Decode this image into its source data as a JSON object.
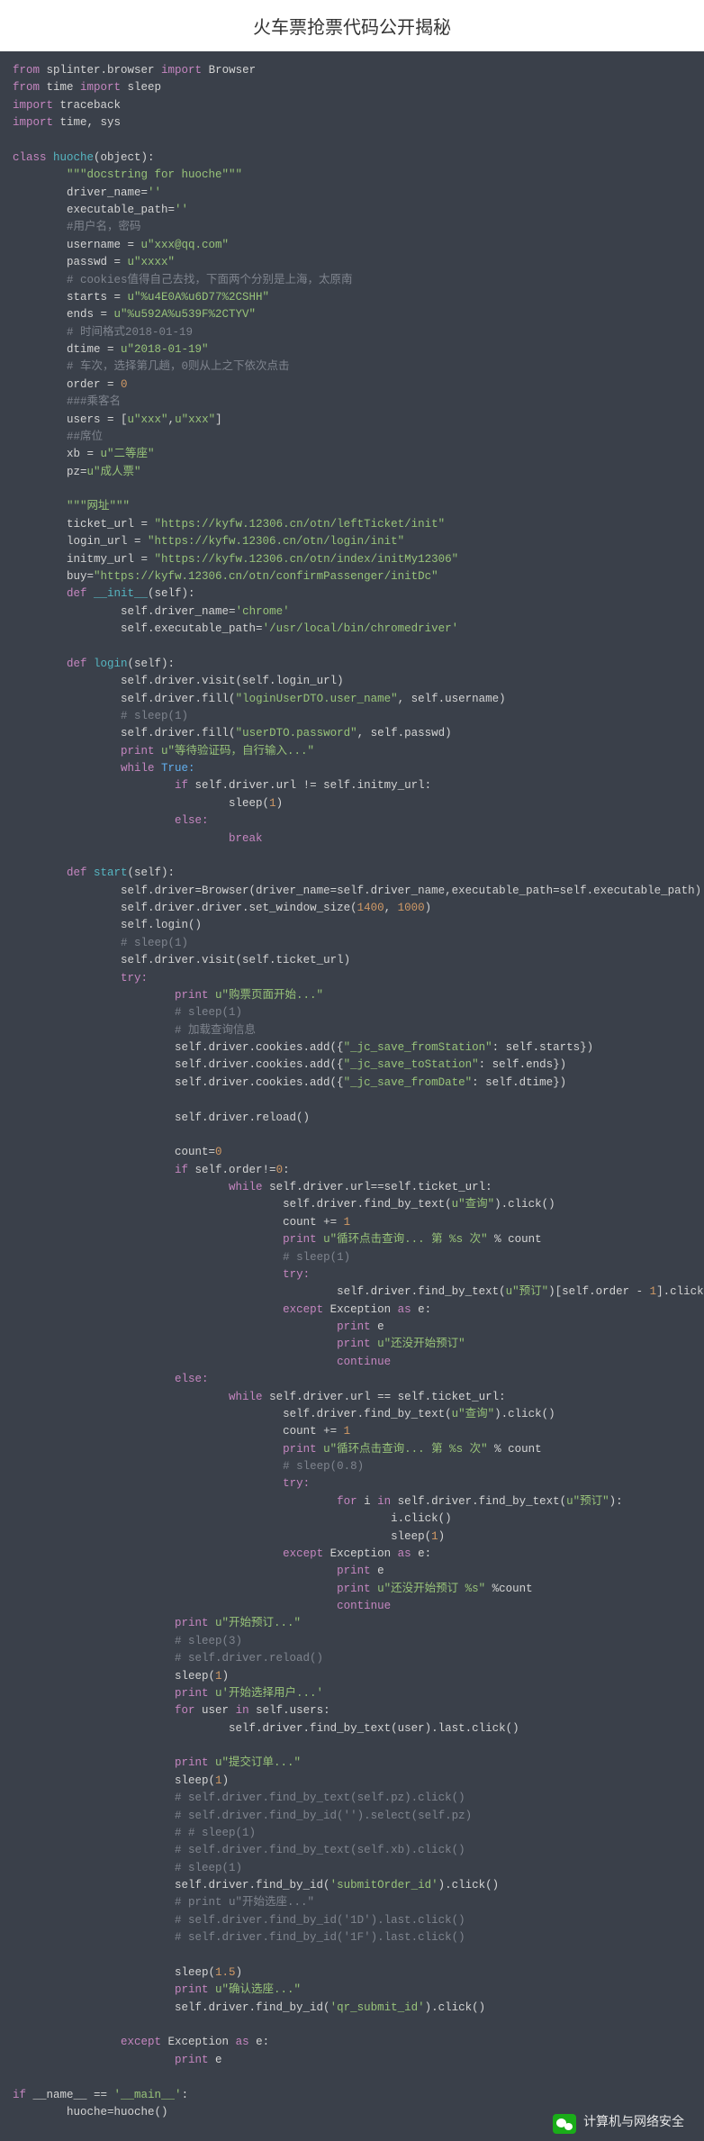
{
  "title": "火车票抢票代码公开揭秘",
  "footer": "计算机与网络安全",
  "code": {
    "l1": {
      "a": "from",
      "b": " splinter.browser ",
      "c": "import",
      "d": " Browser"
    },
    "l2": {
      "a": "from",
      "b": " time ",
      "c": "import",
      "d": " sleep"
    },
    "l3": {
      "a": "import",
      "b": " traceback"
    },
    "l4": {
      "a": "import",
      "b": " time, sys"
    },
    "l5": {
      "a": "class",
      "b": " huoche",
      "c": "(object):"
    },
    "l6": "\"\"\"docstring for huoche\"\"\"",
    "l7": {
      "a": "driver_name=",
      "b": "''"
    },
    "l8": {
      "a": "executable_path=",
      "b": "''"
    },
    "l9": "#用户名，密码",
    "l10": {
      "a": "username = ",
      "b": "u\"xxx@qq.com\""
    },
    "l11": {
      "a": "passwd = ",
      "b": "u\"xxxx\""
    },
    "l12": "# cookies值得自己去找，下面两个分别是上海，太原南",
    "l13": {
      "a": "starts = ",
      "b": "u\"%u4E0A%u6D77%2CSHH\""
    },
    "l14": {
      "a": "ends = ",
      "b": "u\"%u592A%u539F%2CTYV\""
    },
    "l15": "# 时间格式2018-01-19",
    "l16": {
      "a": "dtime = ",
      "b": "u\"2018-01-19\""
    },
    "l17": "# 车次，选择第几趟，0则从上之下依次点击",
    "l18": {
      "a": "order = ",
      "b": "0"
    },
    "l19": "###乘客名",
    "l20": {
      "a": "users = [",
      "b": "u\"xxx\"",
      "c": ",",
      "d": "u\"xxx\"",
      "e": "]"
    },
    "l21": "##席位",
    "l22": {
      "a": "xb = ",
      "b": "u\"二等座\""
    },
    "l23": {
      "a": "pz=",
      "b": "u\"成人票\""
    },
    "l24": "\"\"\"网址\"\"\"",
    "l25": {
      "a": "ticket_url = ",
      "b": "\"https://kyfw.12306.cn/otn/leftTicket/init\""
    },
    "l26": {
      "a": "login_url = ",
      "b": "\"https://kyfw.12306.cn/otn/login/init\""
    },
    "l27": {
      "a": "initmy_url = ",
      "b": "\"https://kyfw.12306.cn/otn/index/initMy12306\""
    },
    "l28": {
      "a": "buy=",
      "b": "\"https://kyfw.12306.cn/otn/confirmPassenger/initDc\""
    },
    "l28b": {
      "a": "def",
      "b": " __init__",
      "c": "(self):"
    },
    "l29": {
      "a": "self.driver_name=",
      "b": "'chrome'"
    },
    "l30": {
      "a": "self.executable_path=",
      "b": "'/usr/local/bin/chromedriver'"
    },
    "l31": {
      "a": "def",
      "b": " login",
      "c": "(self):"
    },
    "l32": "self.driver.visit(self.login_url)",
    "l33": {
      "a": "self.driver.fill(",
      "b": "\"loginUserDTO.user_name\"",
      "c": ", self.username)"
    },
    "l34": "# sleep(1)",
    "l35": {
      "a": "self.driver.fill(",
      "b": "\"userDTO.password\"",
      "c": ", self.passwd)"
    },
    "l36": {
      "a": "print",
      "b": " u\"等待验证码，自行输入...\""
    },
    "l37": {
      "a": "while",
      "b": " True:"
    },
    "l38": {
      "a": "if",
      "b": " self.driver.url != self.initmy_url:"
    },
    "l39": {
      "a": "sleep(",
      "b": "1",
      "c": ")"
    },
    "l40": "else:",
    "l41": "break",
    "l42": {
      "a": "def",
      "b": " start",
      "c": "(self):"
    },
    "l43": "self.driver=Browser(driver_name=self.driver_name,executable_path=self.executable_path)",
    "l44": {
      "a": "self.driver.driver.set_window_size(",
      "b": "1400",
      "c": ", ",
      "d": "1000",
      "e": ")"
    },
    "l45": "self.login()",
    "l46": "# sleep(1)",
    "l47": "self.driver.visit(self.ticket_url)",
    "l48": "try:",
    "l49": {
      "a": "print",
      "b": " u\"购票页面开始...\""
    },
    "l50": "# sleep(1)",
    "l51": "# 加载查询信息",
    "l52": {
      "a": "self.driver.cookies.add({",
      "b": "\"_jc_save_fromStation\"",
      "c": ": self.starts})"
    },
    "l53": {
      "a": "self.driver.cookies.add({",
      "b": "\"_jc_save_toStation\"",
      "c": ": self.ends})"
    },
    "l54": {
      "a": "self.driver.cookies.add({",
      "b": "\"_jc_save_fromDate\"",
      "c": ": self.dtime})"
    },
    "l55": "self.driver.reload()",
    "l56": {
      "a": "count=",
      "b": "0"
    },
    "l57": {
      "a": "if",
      "b": " self.order!=",
      "c": "0",
      "d": ":"
    },
    "l58": {
      "a": "while",
      "b": " self.driver.url==self.ticket_url:"
    },
    "l58b": {
      "a": "self.driver.find_by_text(",
      "b": "u\"查询\"",
      "c": ").click()"
    },
    "l58c": {
      "a": "count += ",
      "b": "1"
    },
    "l59": {
      "a": "print",
      "b": " u\"循环点击查询... 第 %s 次\"",
      "c": " % count"
    },
    "l60": "# sleep(1)",
    "l61": "try:",
    "l62": {
      "a": "self.driver.find_by_text(",
      "b": "u\"预订\"",
      "c": ")[self.order - ",
      "d": "1",
      "e": "].click()"
    },
    "l63": {
      "a": "except",
      "b": " Exception ",
      "c": "as",
      "d": " e:"
    },
    "l64": {
      "a": "print",
      "b": " e"
    },
    "l65": {
      "a": "print",
      "b": " u\"还没开始预订\""
    },
    "l66": "continue",
    "l67": "else:",
    "l68": {
      "a": "while",
      "b": " self.driver.url == self.ticket_url:"
    },
    "l69": {
      "a": "self.driver.find_by_text(",
      "b": "u\"查询\"",
      "c": ").click()"
    },
    "l70": {
      "a": "count += ",
      "b": "1"
    },
    "l71": {
      "a": "print",
      "b": " u\"循环点击查询... 第 %s 次\"",
      "c": " % count"
    },
    "l72": "# sleep(0.8)",
    "l73": "try:",
    "l74": {
      "a": "for",
      "b": " i ",
      "c": "in",
      "d": " self.driver.find_by_text(",
      "e": "u\"预订\"",
      "f": "):"
    },
    "l75": "i.click()",
    "l76": {
      "a": "sleep(",
      "b": "1",
      "c": ")"
    },
    "l77": {
      "a": "except",
      "b": " Exception ",
      "c": "as",
      "d": " e:"
    },
    "l78": {
      "a": "print",
      "b": " e"
    },
    "l79": {
      "a": "print",
      "b": " u\"还没开始预订 %s\"",
      "c": " %count"
    },
    "l80": "continue",
    "l81": {
      "a": "print",
      "b": " u\"开始预订...\""
    },
    "l82": "# sleep(3)",
    "l83": "# self.driver.reload()",
    "l84": {
      "a": "sleep(",
      "b": "1",
      "c": ")"
    },
    "l85": {
      "a": "print",
      "b": " u'开始选择用户...'"
    },
    "l86": {
      "a": "for",
      "b": " user ",
      "c": "in",
      "d": " self.users:"
    },
    "l87": "self.driver.find_by_text(user).last.click()",
    "l88": {
      "a": "print",
      "b": " u\"提交订单...\""
    },
    "l89": {
      "a": "sleep(",
      "b": "1",
      "c": ")"
    },
    "l90": "# self.driver.find_by_text(self.pz).click()",
    "l91": "# self.driver.find_by_id('').select(self.pz)",
    "l92": "# # sleep(1)",
    "l93": "# self.driver.find_by_text(self.xb).click()",
    "l94": "# sleep(1)",
    "l95": {
      "a": "self.driver.find_by_id(",
      "b": "'submitOrder_id'",
      "c": ").click()"
    },
    "l96": "# print u\"开始选座...\"",
    "l97": "# self.driver.find_by_id('1D').last.click()",
    "l98": "# self.driver.find_by_id('1F').last.click()",
    "l99": {
      "a": "sleep(",
      "b": "1.5",
      "c": ")"
    },
    "l100": {
      "a": "print",
      "b": " u\"确认选座...\""
    },
    "l101": {
      "a": "self.driver.find_by_id(",
      "b": "'qr_submit_id'",
      "c": ").click()"
    },
    "l102": {
      "a": "except",
      "b": " Exception ",
      "c": "as",
      "d": " e:"
    },
    "l103": {
      "a": "print",
      "b": " e"
    },
    "l104": {
      "a": "if",
      "b": " __name__ == ",
      "c": "'__main__'",
      "d": ":"
    },
    "l105": "huoche=huoche()"
  }
}
